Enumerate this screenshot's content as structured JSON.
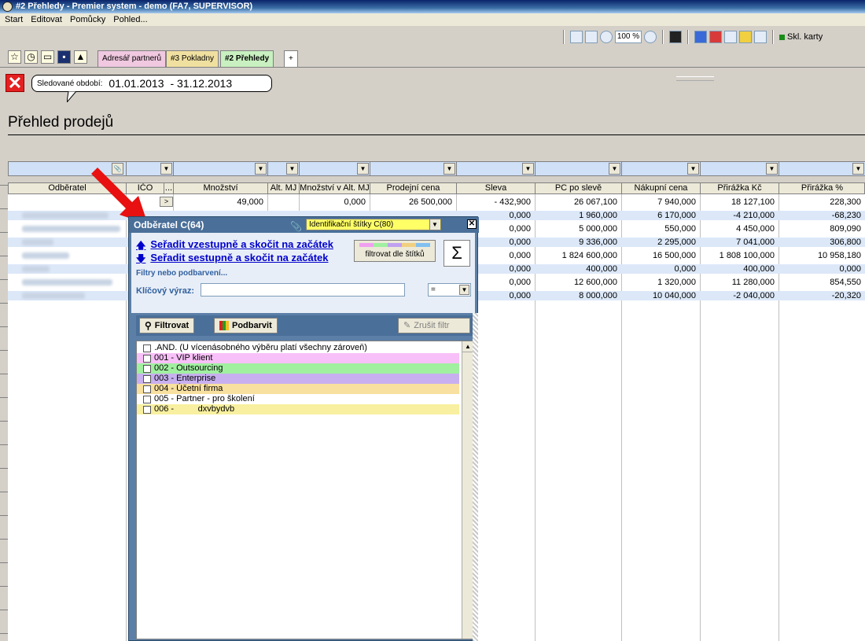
{
  "window": {
    "title": "#2 Přehledy - Premier system - demo (FA7, SUPERVISOR)"
  },
  "menu": [
    "Start",
    "Editovat",
    "Pomůcky",
    "Pohled..."
  ],
  "toolbar": {
    "zoom": "100 %",
    "skl_karty": "Skl. karty"
  },
  "tabs": [
    "Adresář partnerů",
    "#3 Pokladny",
    "#2 Přehledy",
    "+"
  ],
  "period": {
    "label": "Sledované období:",
    "from": "01.01.2013",
    "to": "- 31.12.2013"
  },
  "page_title": "Přehled prodejů",
  "columns": [
    "Odběratel",
    "IČO",
    "...",
    "Množství",
    "Alt. MJ",
    "Množství v Alt. MJ",
    "Prodejní cena",
    "Sleva",
    "PC po slevě",
    "Nákupní cena",
    "Přirážka Kč",
    "Přirážka %"
  ],
  "rows": [
    {
      "mnozstvi": "49,000",
      "mnozstvi_alt": "0,000",
      "prodejni": "26 500,000",
      "sleva": "- 432,900",
      "pc_po_sleve": "26 067,100",
      "nakupni": "7 940,000",
      "prirazka_kc": "18 127,100",
      "prirazka_pct": "228,300"
    },
    {
      "mnozstvi": "",
      "mnozstvi_alt": "",
      "prodejni": "",
      "sleva": "0,000",
      "pc_po_sleve": "1 960,000",
      "nakupni": "6 170,000",
      "prirazka_kc": "-4 210,000",
      "prirazka_pct": "-68,230"
    },
    {
      "mnozstvi": "",
      "mnozstvi_alt": "",
      "prodejni": "",
      "sleva": "0,000",
      "pc_po_sleve": "5 000,000",
      "nakupni": "550,000",
      "prirazka_kc": "4 450,000",
      "prirazka_pct": "809,090"
    },
    {
      "mnozstvi": "",
      "mnozstvi_alt": "",
      "prodejni": "",
      "sleva": "0,000",
      "pc_po_sleve": "9 336,000",
      "nakupni": "2 295,000",
      "prirazka_kc": "7 041,000",
      "prirazka_pct": "306,800"
    },
    {
      "mnozstvi": "",
      "mnozstvi_alt": "",
      "prodejni": "",
      "sleva": "0,000",
      "pc_po_sleve": "1 824 600,000",
      "nakupni": "16 500,000",
      "prirazka_kc": "1 808 100,000",
      "prirazka_pct": "10 958,180"
    },
    {
      "mnozstvi": "",
      "mnozstvi_alt": "",
      "prodejni": "",
      "sleva": "0,000",
      "pc_po_sleve": "400,000",
      "nakupni": "0,000",
      "prirazka_kc": "400,000",
      "prirazka_pct": "0,000"
    },
    {
      "mnozstvi": "",
      "mnozstvi_alt": "",
      "prodejni": "",
      "sleva": "0,000",
      "pc_po_sleve": "12 600,000",
      "nakupni": "1 320,000",
      "prirazka_kc": "11 280,000",
      "prirazka_pct": "854,550"
    },
    {
      "mnozstvi": "",
      "mnozstvi_alt": "",
      "prodejni": "",
      "sleva": "0,000",
      "pc_po_sleve": "8 000,000",
      "nakupni": "10 040,000",
      "prirazka_kc": "-2 040,000",
      "prirazka_pct": "-20,320"
    }
  ],
  "popup": {
    "title": "Odběratel C(64)",
    "select_value": "Identifikační štítky  C(80)",
    "sort_asc": "Seřadit vzestupně a skočit na začátek",
    "sort_desc": "Seřadit sestupně a skočit na začátek",
    "filter_by_labels": "filtrovat dle štítků",
    "sigma": "Σ",
    "filter_hint": "Filtry nebo podbarvení...",
    "keyword_label": "Klíčový výraz:",
    "keyword_value": "",
    "operator": "=",
    "btn_filter": "Filtrovat",
    "btn_color": "Podbarvit",
    "btn_cancel": "Zrušit filtr",
    "items": [
      {
        "label": ".AND. (U vícenásobného výběru platí všechny zároveň)",
        "color": "#ffffff"
      },
      {
        "label": "001 - VIP klient",
        "color": "#f8c0f8"
      },
      {
        "label": "002 - Outsourcing",
        "color": "#a0f0a0"
      },
      {
        "label": "003 - Enterprise",
        "color": "#c8b0f0"
      },
      {
        "label": "004 - Účetní firma",
        "color": "#f8e0a0"
      },
      {
        "label": "005 - Partner - pro školení",
        "color": "#ffffff"
      },
      {
        "label": "006 -          dxvbydvb",
        "color": "#f8f0a0"
      }
    ]
  }
}
